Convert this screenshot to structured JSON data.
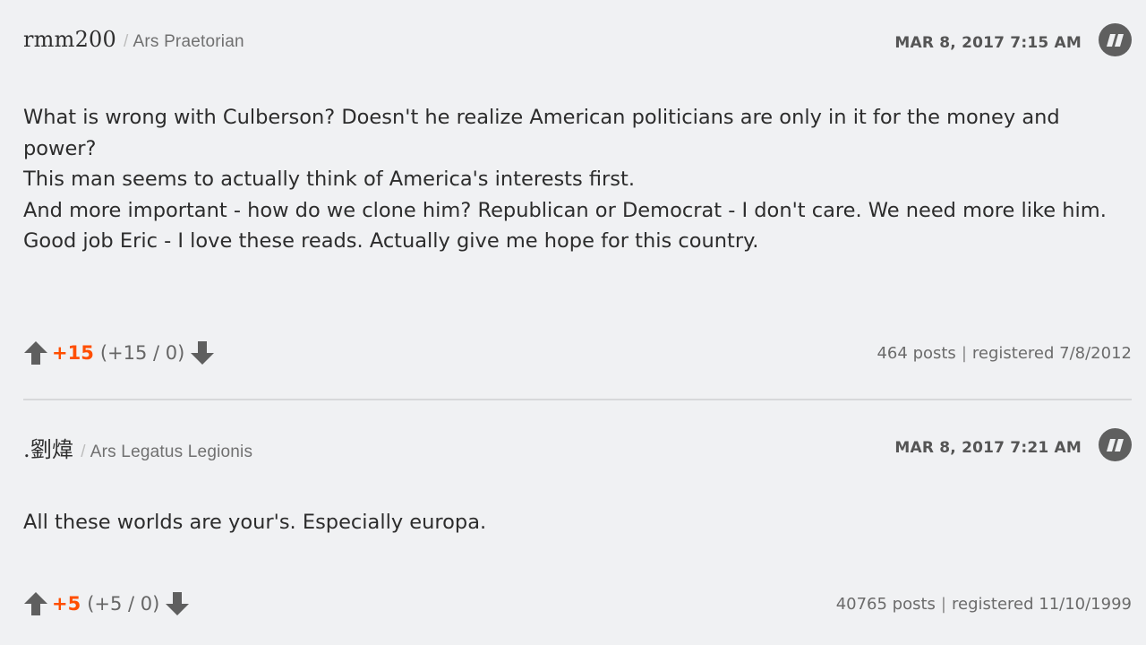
{
  "comments": [
    {
      "author": "rmm200",
      "rank_sep": "/",
      "rank": "Ars Praetorian",
      "timestamp": "MAR 8, 2017 7:15 AM",
      "body": "What is wrong with Culberson? Doesn't he realize American politicians are only in it for the money and power?\nThis man seems to actually think of America's interests first.\nAnd more important - how do we clone him? Republican or Democrat - I don't care. We need more like him.\nGood job Eric - I love these reads. Actually give me hope for this country.",
      "score": "+15",
      "breakdown": "(+15 / 0)",
      "posts": "464 posts",
      "meta_sep": "|",
      "registered": "registered 7/8/2012"
    },
    {
      "author": ".劉煒",
      "rank_sep": "/",
      "rank": "Ars Legatus Legionis",
      "timestamp": "MAR 8, 2017 7:21 AM",
      "body": "All these worlds are your's. Especially europa.",
      "score": "+5",
      "breakdown": "(+5 / 0)",
      "posts": "40765 posts",
      "meta_sep": "|",
      "registered": "registered 11/10/1999"
    }
  ],
  "icons": {
    "quote": "quote-icon",
    "upvote": "upvote-arrow-icon",
    "downvote": "downvote-arrow-icon"
  },
  "colors": {
    "background": "#f0f1f3",
    "score": "#ff4e00",
    "icon": "#5f5f5f",
    "divider": "#d7d8da"
  }
}
